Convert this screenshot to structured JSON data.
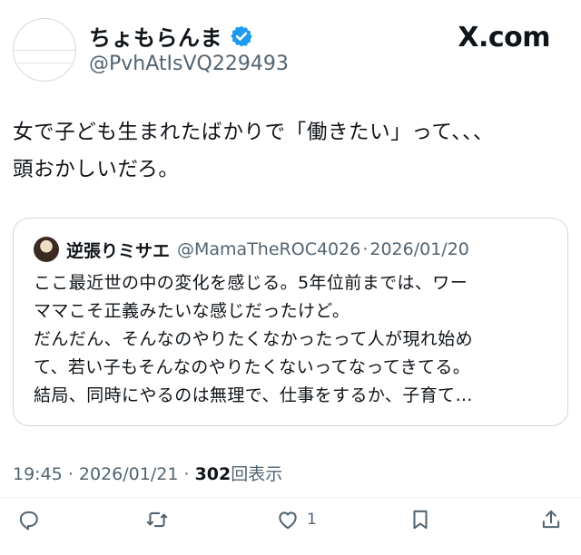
{
  "author": {
    "display_name": "ちょもらんま",
    "handle": "@PvhAtIsVQ229493",
    "verified": true
  },
  "brand": "X.com",
  "tweet": {
    "text": "女で子ども生まれたばかりで「働きたい」って、、、\n頭おかしいだろ。"
  },
  "quoted": {
    "display_name": "逆張りミサエ",
    "handle": "@MamaTheROC4026",
    "separator": "·",
    "date": "2026/01/20",
    "lines": [
      "ここ最近世の中の変化を感じる。5年位前までは、ワー",
      "ママこそ正義みたいな感じだったけど。",
      "だんだん、そんなのやりたくなかったって人が現れ始め",
      "て、若い子もそんなのやりたくないってなってきてる。",
      "結局、同時にやるのは無理で、仕事をするか、子育て…"
    ]
  },
  "meta": {
    "time": "19:45",
    "separator": "·",
    "date": "2026/01/21",
    "dot": "·",
    "views": "302",
    "views_label": "回表示"
  },
  "actions": {
    "reply_icon": "reply-icon",
    "retweet_icon": "retweet-icon",
    "like_icon": "like-icon",
    "like_count": "1",
    "bookmark_icon": "bookmark-icon",
    "share_icon": "share-icon"
  },
  "colors": {
    "verified_blue": "#1d9bf0",
    "text": "#0f1419",
    "secondary": "#536471",
    "border": "#cfd9de"
  }
}
